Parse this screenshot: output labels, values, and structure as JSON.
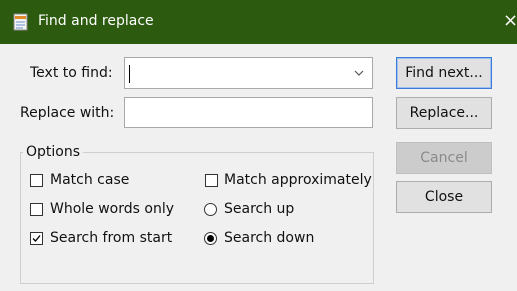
{
  "window": {
    "title": "Find and replace",
    "close_glyph": "×",
    "titlebar_color": "#2c5a0f",
    "app_icon": "notepad-app-icon"
  },
  "find": {
    "label": "Text to find:",
    "value": ""
  },
  "replace": {
    "label": "Replace with:",
    "value": ""
  },
  "buttons": {
    "find_next": "Find next...",
    "replace": "Replace...",
    "cancel": "Cancel",
    "close": "Close"
  },
  "options": {
    "legend": "Options",
    "match_case": {
      "label": "Match case",
      "checked": false
    },
    "whole_words": {
      "label": "Whole words only",
      "checked": false
    },
    "search_from_start": {
      "label": "Search from start",
      "checked": true
    },
    "match_approximately": {
      "label": "Match approximately",
      "checked": false
    },
    "search_up": {
      "label": "Search up",
      "selected": false
    },
    "search_down": {
      "label": "Search down",
      "selected": true
    }
  }
}
